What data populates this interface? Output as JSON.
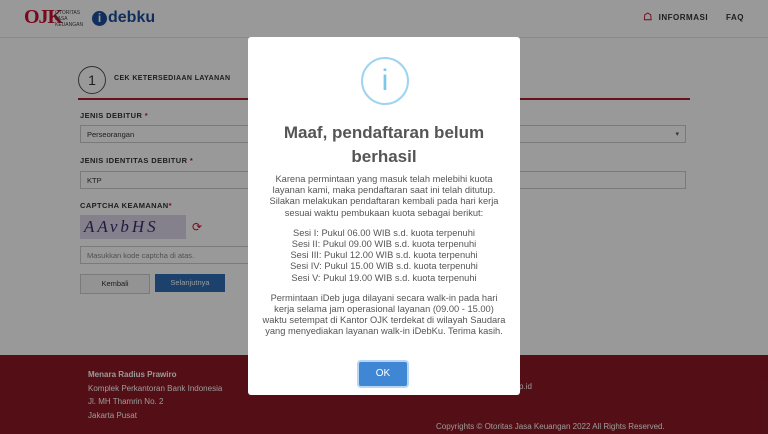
{
  "header": {
    "ojk_logo": "OJK",
    "ojk_subtitle": "OTORITAS JASA KEUANGAN",
    "app_logo": "debku",
    "app_logo_i": "i",
    "nav": {
      "informasi": "INFORMASI",
      "faq": "FAQ"
    }
  },
  "form": {
    "step_number": "1",
    "step_label": "CEK KETERSEDIAAN LAYANAN",
    "jenis_debitur_label": "JENIS DEBITUR",
    "jenis_debitur_value": "Perseorangan",
    "jenis_identitas_label": "JENIS IDENTITAS DEBITUR",
    "jenis_identitas_value": "KTP",
    "captcha_label": "CAPTCHA KEAMANAN",
    "required_mark": "*",
    "captcha_text": "AAvbHS",
    "captcha_placeholder": "Masukkan kode captcha di atas.",
    "back_label": "Kembali",
    "next_label": "Selanjutnya"
  },
  "footer": {
    "name": "Menara Radius Prawiro",
    "addr1": "Komplek Perkantoran Bank Indonesia",
    "addr2": "Jl. MH Thamrin No. 2",
    "addr3": "Jakarta Pusat",
    "email_fragment": "p.id",
    "copyright": "Copyrights © Otoritas Jasa Keuangan 2022 All Rights Reserved."
  },
  "modal": {
    "icon_glyph": "i",
    "title": "Maaf, pendaftaran belum berhasil",
    "para1": "Karena permintaan yang masuk telah melebihi kuota layanan kami, maka pendaftaran saat ini telah ditutup. Silakan melakukan pendaftaran kembali pada hari kerja sesuai waktu pembukaan kuota sebagai berikut:",
    "sessions": [
      "Sesi I: Pukul 06.00 WIB s.d. kuota terpenuhi",
      "Sesi II: Pukul 09.00 WIB s.d. kuota terpenuhi",
      "Sesi III: Pukul 12.00 WIB s.d. kuota terpenuhi",
      "Sesi IV: Pukul 15.00 WIB s.d. kuota terpenuhi",
      "Sesi V: Pukul 19.00 WIB s.d. kuota terpenuhi"
    ],
    "para3": "Permintaan iDeb juga dilayani secara walk-in pada hari kerja selama jam operasional layanan (09.00 - 15.00) waktu setempat di Kantor OJK terdekat di wilayah Saudara yang menyediakan layanan walk-in iDebKu. Terima kasih.",
    "ok_label": "OK"
  },
  "colors": {
    "brand_red": "#c8102e",
    "footer_red": "#8b1a24",
    "button_blue": "#2d6db5",
    "ok_blue": "#3f87d4",
    "info_icon": "#9dd4f0"
  },
  "icons": {
    "home": "home-icon",
    "refresh": "refresh-icon",
    "dropdown": "chevron-down-icon",
    "info": "info-icon"
  }
}
